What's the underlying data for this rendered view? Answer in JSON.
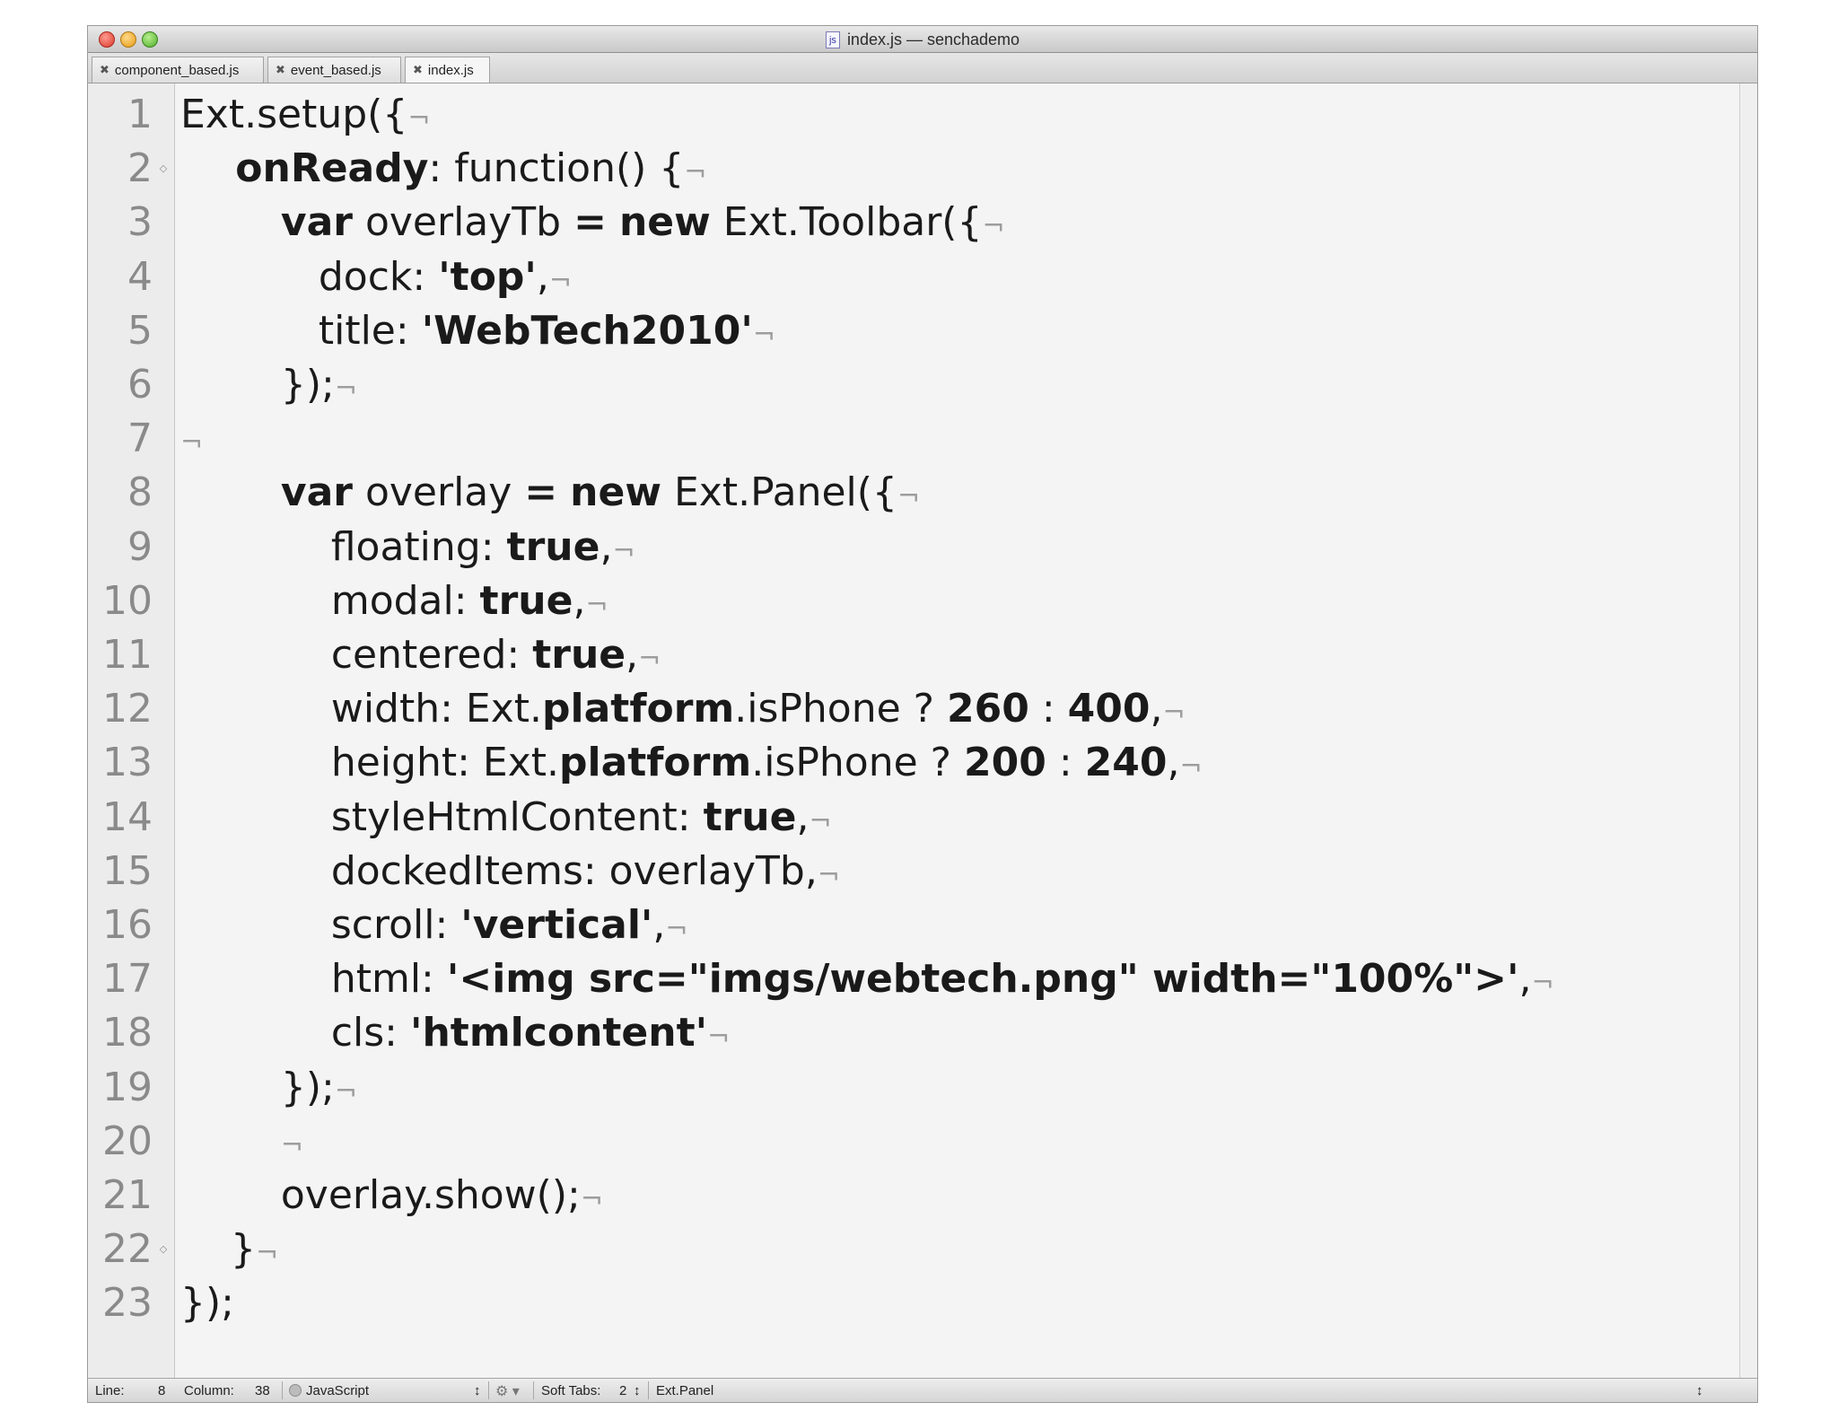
{
  "window": {
    "title": "index.js — senchademo",
    "file_icon_label": "js"
  },
  "tabs": [
    {
      "label": "component_based.js",
      "close": "✖"
    },
    {
      "label": "event_based.js",
      "close": "✖"
    },
    {
      "label": "index.js",
      "close": "✖"
    }
  ],
  "active_tab": "index.js",
  "code": {
    "eol_marker": "¬",
    "lines": [
      {
        "num": "1",
        "tokens": [
          {
            "t": "Ext.setup({",
            "c": ""
          }
        ]
      },
      {
        "num": "2",
        "tokens": [
          {
            "t": "    onReady",
            "c": "kw"
          },
          {
            "t": ": function() {",
            "c": ""
          }
        ]
      },
      {
        "num": "3",
        "tokens": [
          {
            "t": "        ",
            "c": ""
          },
          {
            "t": "var",
            "c": "kw"
          },
          {
            "t": " overlayTb ",
            "c": ""
          },
          {
            "t": "=",
            "c": "kw"
          },
          {
            "t": " ",
            "c": ""
          },
          {
            "t": "new",
            "c": "kw"
          },
          {
            "t": " Ext.Toolbar({",
            "c": ""
          }
        ]
      },
      {
        "num": "4",
        "tokens": [
          {
            "t": "           dock: ",
            "c": ""
          },
          {
            "t": "'top'",
            "c": "str"
          },
          {
            "t": ",",
            "c": ""
          }
        ]
      },
      {
        "num": "5",
        "tokens": [
          {
            "t": "           title: ",
            "c": ""
          },
          {
            "t": "'WebTech2010'",
            "c": "str"
          }
        ]
      },
      {
        "num": "6",
        "tokens": [
          {
            "t": "        });",
            "c": ""
          }
        ]
      },
      {
        "num": "7",
        "tokens": []
      },
      {
        "num": "8",
        "tokens": [
          {
            "t": "        ",
            "c": ""
          },
          {
            "t": "var",
            "c": "kw"
          },
          {
            "t": " overlay ",
            "c": ""
          },
          {
            "t": "=",
            "c": "kw"
          },
          {
            "t": " ",
            "c": ""
          },
          {
            "t": "new",
            "c": "kw"
          },
          {
            "t": " Ext.Panel({",
            "c": ""
          }
        ]
      },
      {
        "num": "9",
        "tokens": [
          {
            "t": "            floating: ",
            "c": ""
          },
          {
            "t": "true",
            "c": "kw"
          },
          {
            "t": ",",
            "c": ""
          }
        ]
      },
      {
        "num": "10",
        "tokens": [
          {
            "t": "            modal: ",
            "c": ""
          },
          {
            "t": "true",
            "c": "kw"
          },
          {
            "t": ",",
            "c": ""
          }
        ]
      },
      {
        "num": "11",
        "tokens": [
          {
            "t": "            centered: ",
            "c": ""
          },
          {
            "t": "true",
            "c": "kw"
          },
          {
            "t": ",",
            "c": ""
          }
        ]
      },
      {
        "num": "12",
        "tokens": [
          {
            "t": "            width: Ext.",
            "c": ""
          },
          {
            "t": "platform",
            "c": "kw"
          },
          {
            "t": ".isPhone ? ",
            "c": ""
          },
          {
            "t": "260",
            "c": "num"
          },
          {
            "t": " : ",
            "c": ""
          },
          {
            "t": "400",
            "c": "num"
          },
          {
            "t": ",",
            "c": ""
          }
        ]
      },
      {
        "num": "13",
        "tokens": [
          {
            "t": "            height: Ext.",
            "c": ""
          },
          {
            "t": "platform",
            "c": "kw"
          },
          {
            "t": ".isPhone ? ",
            "c": ""
          },
          {
            "t": "200",
            "c": "num"
          },
          {
            "t": " : ",
            "c": ""
          },
          {
            "t": "240",
            "c": "num"
          },
          {
            "t": ",",
            "c": ""
          }
        ]
      },
      {
        "num": "14",
        "tokens": [
          {
            "t": "            styleHtmlContent: ",
            "c": ""
          },
          {
            "t": "true",
            "c": "kw"
          },
          {
            "t": ",",
            "c": ""
          }
        ]
      },
      {
        "num": "15",
        "tokens": [
          {
            "t": "            dockedItems: overlayTb,",
            "c": ""
          }
        ]
      },
      {
        "num": "16",
        "tokens": [
          {
            "t": "            scroll: ",
            "c": ""
          },
          {
            "t": "'vertical'",
            "c": "str"
          },
          {
            "t": ",",
            "c": ""
          }
        ]
      },
      {
        "num": "17",
        "tokens": [
          {
            "t": "            html: ",
            "c": ""
          },
          {
            "t": "'<img src=\"imgs/webtech.png\" width=\"100%\">'",
            "c": "str"
          },
          {
            "t": ",",
            "c": ""
          }
        ]
      },
      {
        "num": "18",
        "tokens": [
          {
            "t": "            cls: ",
            "c": ""
          },
          {
            "t": "'htmlcontent'",
            "c": "str"
          }
        ]
      },
      {
        "num": "19",
        "tokens": [
          {
            "t": "        });",
            "c": ""
          }
        ]
      },
      {
        "num": "20",
        "tokens": [
          {
            "t": "        ",
            "c": ""
          }
        ]
      },
      {
        "num": "21",
        "tokens": [
          {
            "t": "        overlay.show();",
            "c": ""
          }
        ]
      },
      {
        "num": "22",
        "tokens": [
          {
            "t": "    }",
            "c": ""
          }
        ]
      },
      {
        "num": "23",
        "tokens": [
          {
            "t": "});",
            "c": ""
          }
        ]
      }
    ],
    "eol_lines": [
      "1",
      "2",
      "3",
      "4",
      "5",
      "6",
      "7",
      "8",
      "9",
      "10",
      "11",
      "12",
      "13",
      "14",
      "15",
      "16",
      "17",
      "18",
      "19",
      "20",
      "21",
      "22"
    ],
    "fold_lines": [
      "2",
      "22"
    ],
    "fold_marker": "◇"
  },
  "status": {
    "line_label": "Line:",
    "line_value": "8",
    "column_label": "Column:",
    "column_value": "38",
    "language": "JavaScript",
    "updown": "↕",
    "gear": "⚙ ▾",
    "tabs_label": "Soft Tabs:",
    "tabs_value": "2",
    "symbol": "Ext.Panel"
  }
}
